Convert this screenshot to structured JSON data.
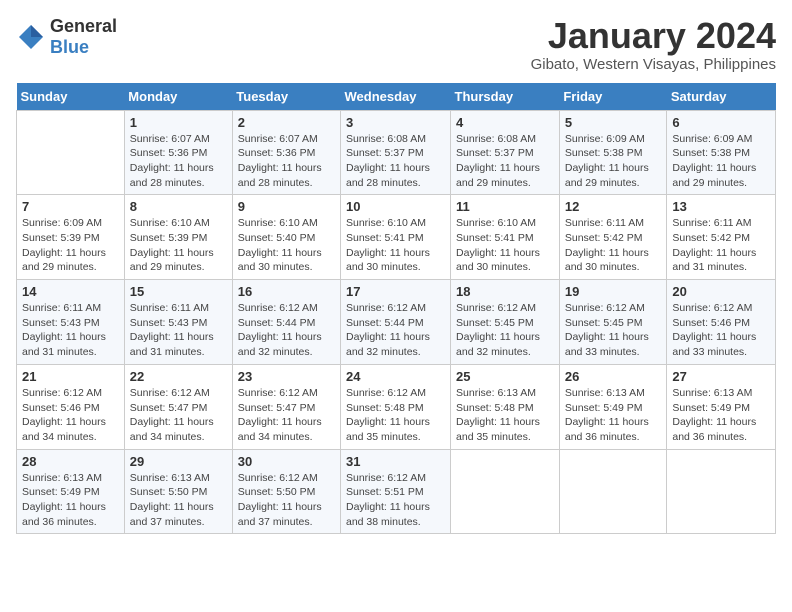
{
  "logo": {
    "general": "General",
    "blue": "Blue"
  },
  "title": "January 2024",
  "location": "Gibato, Western Visayas, Philippines",
  "days_header": [
    "Sunday",
    "Monday",
    "Tuesday",
    "Wednesday",
    "Thursday",
    "Friday",
    "Saturday"
  ],
  "weeks": [
    [
      {
        "day": "",
        "sunrise": "",
        "sunset": "",
        "daylight": ""
      },
      {
        "day": "1",
        "sunrise": "Sunrise: 6:07 AM",
        "sunset": "Sunset: 5:36 PM",
        "daylight": "Daylight: 11 hours and 28 minutes."
      },
      {
        "day": "2",
        "sunrise": "Sunrise: 6:07 AM",
        "sunset": "Sunset: 5:36 PM",
        "daylight": "Daylight: 11 hours and 28 minutes."
      },
      {
        "day": "3",
        "sunrise": "Sunrise: 6:08 AM",
        "sunset": "Sunset: 5:37 PM",
        "daylight": "Daylight: 11 hours and 28 minutes."
      },
      {
        "day": "4",
        "sunrise": "Sunrise: 6:08 AM",
        "sunset": "Sunset: 5:37 PM",
        "daylight": "Daylight: 11 hours and 29 minutes."
      },
      {
        "day": "5",
        "sunrise": "Sunrise: 6:09 AM",
        "sunset": "Sunset: 5:38 PM",
        "daylight": "Daylight: 11 hours and 29 minutes."
      },
      {
        "day": "6",
        "sunrise": "Sunrise: 6:09 AM",
        "sunset": "Sunset: 5:38 PM",
        "daylight": "Daylight: 11 hours and 29 minutes."
      }
    ],
    [
      {
        "day": "7",
        "sunrise": "Sunrise: 6:09 AM",
        "sunset": "Sunset: 5:39 PM",
        "daylight": "Daylight: 11 hours and 29 minutes."
      },
      {
        "day": "8",
        "sunrise": "Sunrise: 6:10 AM",
        "sunset": "Sunset: 5:39 PM",
        "daylight": "Daylight: 11 hours and 29 minutes."
      },
      {
        "day": "9",
        "sunrise": "Sunrise: 6:10 AM",
        "sunset": "Sunset: 5:40 PM",
        "daylight": "Daylight: 11 hours and 30 minutes."
      },
      {
        "day": "10",
        "sunrise": "Sunrise: 6:10 AM",
        "sunset": "Sunset: 5:41 PM",
        "daylight": "Daylight: 11 hours and 30 minutes."
      },
      {
        "day": "11",
        "sunrise": "Sunrise: 6:10 AM",
        "sunset": "Sunset: 5:41 PM",
        "daylight": "Daylight: 11 hours and 30 minutes."
      },
      {
        "day": "12",
        "sunrise": "Sunrise: 6:11 AM",
        "sunset": "Sunset: 5:42 PM",
        "daylight": "Daylight: 11 hours and 30 minutes."
      },
      {
        "day": "13",
        "sunrise": "Sunrise: 6:11 AM",
        "sunset": "Sunset: 5:42 PM",
        "daylight": "Daylight: 11 hours and 31 minutes."
      }
    ],
    [
      {
        "day": "14",
        "sunrise": "Sunrise: 6:11 AM",
        "sunset": "Sunset: 5:43 PM",
        "daylight": "Daylight: 11 hours and 31 minutes."
      },
      {
        "day": "15",
        "sunrise": "Sunrise: 6:11 AM",
        "sunset": "Sunset: 5:43 PM",
        "daylight": "Daylight: 11 hours and 31 minutes."
      },
      {
        "day": "16",
        "sunrise": "Sunrise: 6:12 AM",
        "sunset": "Sunset: 5:44 PM",
        "daylight": "Daylight: 11 hours and 32 minutes."
      },
      {
        "day": "17",
        "sunrise": "Sunrise: 6:12 AM",
        "sunset": "Sunset: 5:44 PM",
        "daylight": "Daylight: 11 hours and 32 minutes."
      },
      {
        "day": "18",
        "sunrise": "Sunrise: 6:12 AM",
        "sunset": "Sunset: 5:45 PM",
        "daylight": "Daylight: 11 hours and 32 minutes."
      },
      {
        "day": "19",
        "sunrise": "Sunrise: 6:12 AM",
        "sunset": "Sunset: 5:45 PM",
        "daylight": "Daylight: 11 hours and 33 minutes."
      },
      {
        "day": "20",
        "sunrise": "Sunrise: 6:12 AM",
        "sunset": "Sunset: 5:46 PM",
        "daylight": "Daylight: 11 hours and 33 minutes."
      }
    ],
    [
      {
        "day": "21",
        "sunrise": "Sunrise: 6:12 AM",
        "sunset": "Sunset: 5:46 PM",
        "daylight": "Daylight: 11 hours and 34 minutes."
      },
      {
        "day": "22",
        "sunrise": "Sunrise: 6:12 AM",
        "sunset": "Sunset: 5:47 PM",
        "daylight": "Daylight: 11 hours and 34 minutes."
      },
      {
        "day": "23",
        "sunrise": "Sunrise: 6:12 AM",
        "sunset": "Sunset: 5:47 PM",
        "daylight": "Daylight: 11 hours and 34 minutes."
      },
      {
        "day": "24",
        "sunrise": "Sunrise: 6:12 AM",
        "sunset": "Sunset: 5:48 PM",
        "daylight": "Daylight: 11 hours and 35 minutes."
      },
      {
        "day": "25",
        "sunrise": "Sunrise: 6:13 AM",
        "sunset": "Sunset: 5:48 PM",
        "daylight": "Daylight: 11 hours and 35 minutes."
      },
      {
        "day": "26",
        "sunrise": "Sunrise: 6:13 AM",
        "sunset": "Sunset: 5:49 PM",
        "daylight": "Daylight: 11 hours and 36 minutes."
      },
      {
        "day": "27",
        "sunrise": "Sunrise: 6:13 AM",
        "sunset": "Sunset: 5:49 PM",
        "daylight": "Daylight: 11 hours and 36 minutes."
      }
    ],
    [
      {
        "day": "28",
        "sunrise": "Sunrise: 6:13 AM",
        "sunset": "Sunset: 5:49 PM",
        "daylight": "Daylight: 11 hours and 36 minutes."
      },
      {
        "day": "29",
        "sunrise": "Sunrise: 6:13 AM",
        "sunset": "Sunset: 5:50 PM",
        "daylight": "Daylight: 11 hours and 37 minutes."
      },
      {
        "day": "30",
        "sunrise": "Sunrise: 6:12 AM",
        "sunset": "Sunset: 5:50 PM",
        "daylight": "Daylight: 11 hours and 37 minutes."
      },
      {
        "day": "31",
        "sunrise": "Sunrise: 6:12 AM",
        "sunset": "Sunset: 5:51 PM",
        "daylight": "Daylight: 11 hours and 38 minutes."
      },
      {
        "day": "",
        "sunrise": "",
        "sunset": "",
        "daylight": ""
      },
      {
        "day": "",
        "sunrise": "",
        "sunset": "",
        "daylight": ""
      },
      {
        "day": "",
        "sunrise": "",
        "sunset": "",
        "daylight": ""
      }
    ]
  ]
}
